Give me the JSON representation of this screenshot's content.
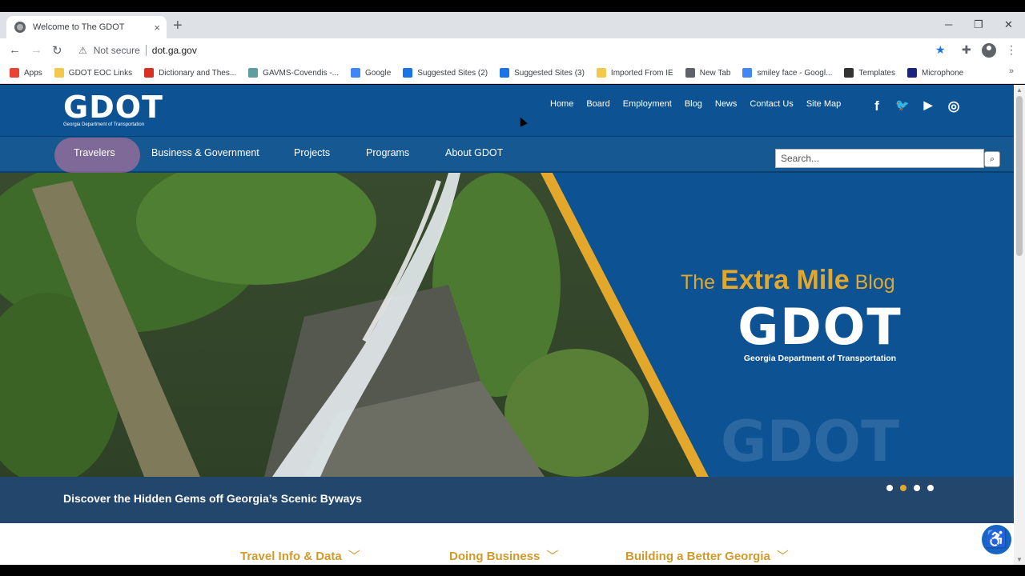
{
  "browser": {
    "tab_title": "Welcome to The GDOT",
    "tab_close": "×",
    "new_tab": "+",
    "security_label": "Not secure",
    "url": "dot.ga.gov",
    "minimize": "─",
    "restore": "❐",
    "close": "✕",
    "bookmarks": [
      {
        "label": "Apps",
        "color": "#ea4335"
      },
      {
        "label": "GDOT EOC Links",
        "color": "#f2c94c"
      },
      {
        "label": "Dictionary and Thes...",
        "color": "#d93025"
      },
      {
        "label": "GAVMS-Covendis -...",
        "color": "#5f9ea0"
      },
      {
        "label": "Google",
        "color": "#4285f4"
      },
      {
        "label": "Suggested Sites (2)",
        "color": "#1a73e8"
      },
      {
        "label": "Suggested Sites (3)",
        "color": "#1a73e8"
      },
      {
        "label": "Imported From IE",
        "color": "#f2c94c"
      },
      {
        "label": "New Tab",
        "color": "#5f6368"
      },
      {
        "label": "smiley face - Googl...",
        "color": "#4285f4"
      },
      {
        "label": "Templates",
        "color": "#333333"
      },
      {
        "label": "Microphone",
        "color": "#1a237e"
      }
    ],
    "bookmarks_more": "»"
  },
  "site": {
    "logo_text": "GDOT",
    "logo_subtitle": "Georgia Department of Transportation",
    "util_nav": [
      "Home",
      "Board",
      "Employment",
      "Blog",
      "News",
      "Contact Us",
      "Site Map"
    ],
    "social": {
      "facebook": "f",
      "twitter": "🐦",
      "youtube": "▶",
      "instagram": "◎"
    },
    "main_nav": [
      "Travelers",
      "Business & Government",
      "Projects",
      "Programs",
      "About GDOT"
    ],
    "search_placeholder": "Search...",
    "search_button": "⌕"
  },
  "hero": {
    "blog_prefix": "The",
    "blog_highlight": "Extra Mile",
    "blog_suffix": "Blog",
    "logo_text": "GDOT",
    "logo_subtitle": "Georgia Department of Transportation",
    "caption": "Discover the Hidden Gems off Georgia’s Scenic Byways",
    "slide_count": 4,
    "active_slide": 2
  },
  "quick_links": [
    "Travel Info & Data",
    "Doing Business",
    "Building a Better Georgia"
  ],
  "accessibility_icon": "♿",
  "colors": {
    "header_blue": "#0d5394",
    "accent_gold": "#e3a82b",
    "quicklink_gold": "#d09a2b"
  }
}
